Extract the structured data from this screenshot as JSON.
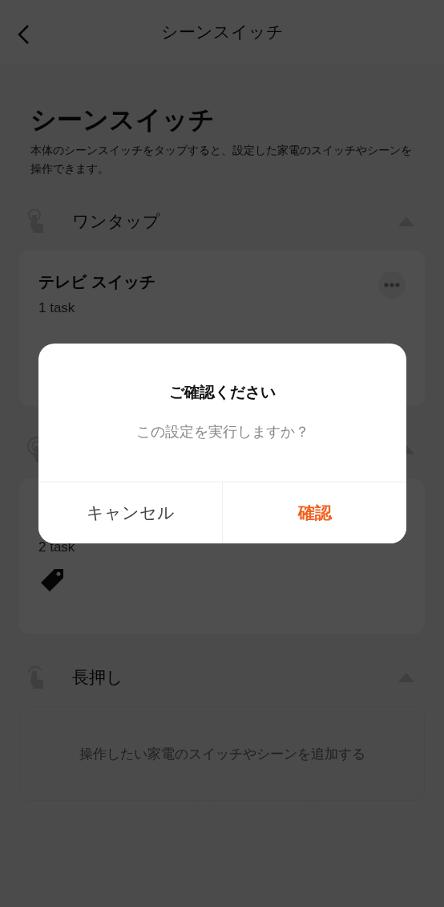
{
  "header": {
    "title": "シーンスイッチ"
  },
  "page": {
    "title": "シーンスイッチ",
    "description": "本体のシーンスイッチをタップすると、設定した家電のスイッチやシーンを操作できます。"
  },
  "sections": [
    {
      "kind": "tap",
      "title": "ワンタップ",
      "expanded": true,
      "cards": [
        {
          "title": "テレビ スイッチ",
          "tasks": "1 task",
          "tagged": false
        }
      ]
    },
    {
      "kind": "double",
      "expanded": true,
      "cards": [
        {
          "tasks": "2 task",
          "tagged": true
        }
      ]
    },
    {
      "kind": "long",
      "title": "長押し",
      "expanded": true,
      "empty_hint": "操作したい家電のスイッチやシーンを追加する"
    }
  ],
  "dialog": {
    "title": "ご確認ください",
    "message": "この設定を実行しますか？",
    "buttons": [
      {
        "label": "キャンセル",
        "kind": "cancel"
      },
      {
        "label": "確認",
        "kind": "confirm"
      }
    ]
  }
}
